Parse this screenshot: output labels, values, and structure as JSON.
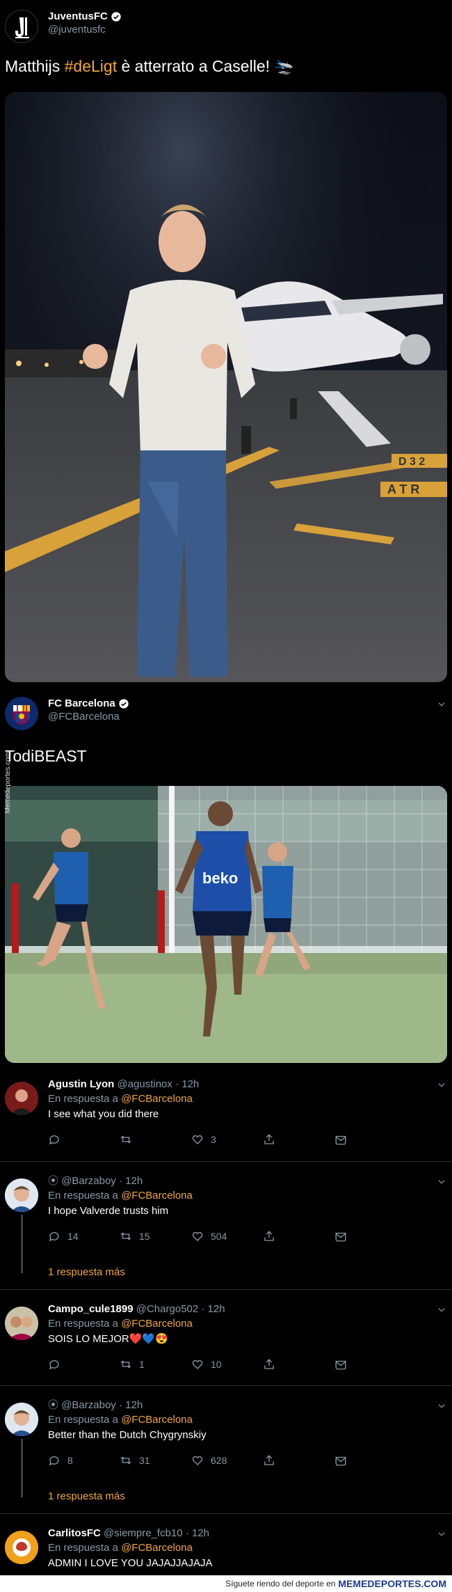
{
  "tweet1": {
    "name": "JuventusFC",
    "handle": "@juventusfc",
    "text_before": "Matthijs ",
    "hashtag": "#deLigt",
    "text_after": " è atterrato a Caselle! 🛬"
  },
  "tweet2": {
    "name": "FC Barcelona",
    "handle": "@FCBarcelona",
    "text": "TodiBEAST"
  },
  "watermark": "Memedeportes.com",
  "replies": [
    {
      "name": "Agustin Lyon",
      "handle": "@agustinox",
      "time": "· 12h",
      "reply_to_label": "En respuesta a",
      "reply_to": "@FCBarcelona",
      "text": "I see what you did there",
      "counts": {
        "reply": "",
        "retweet": "",
        "like": "3"
      }
    },
    {
      "name": "",
      "handle": "@Barzaboy",
      "time": "· 12h",
      "reply_to_label": "En respuesta a",
      "reply_to": "@FCBarcelona",
      "text": "I hope Valverde trusts him",
      "counts": {
        "reply": "14",
        "retweet": "15",
        "like": "504"
      },
      "more": "1 respuesta más"
    },
    {
      "name": "Campo_cule1899",
      "handle": "@Chargo502",
      "time": "· 12h",
      "reply_to_label": "En respuesta a",
      "reply_to": "@FCBarcelona",
      "text": "SOIS LO MEJOR❤️💙😍",
      "counts": {
        "reply": "",
        "retweet": "1",
        "like": "10"
      }
    },
    {
      "name": "",
      "handle": "@Barzaboy",
      "time": "· 12h",
      "reply_to_label": "En respuesta a",
      "reply_to": "@FCBarcelona",
      "text": "Better than the Dutch Chygrynskiy",
      "counts": {
        "reply": "8",
        "retweet": "31",
        "like": "628"
      },
      "more": "1 respuesta más"
    },
    {
      "name": "CarlitosFC",
      "handle": "@siempre_fcb10",
      "time": "· 12h",
      "reply_to_label": "En respuesta a",
      "reply_to": "@FCBarcelona",
      "text": "ADMIN I LOVE YOU JAJAJJAJAJA"
    }
  ],
  "footer": {
    "text": "Síguete riendo del deporte en",
    "brand": "MEMEDEPORTES.COM"
  },
  "colors": {
    "accent": "#f2a63b",
    "muted": "#8899a6",
    "divider": "#2f3336"
  }
}
